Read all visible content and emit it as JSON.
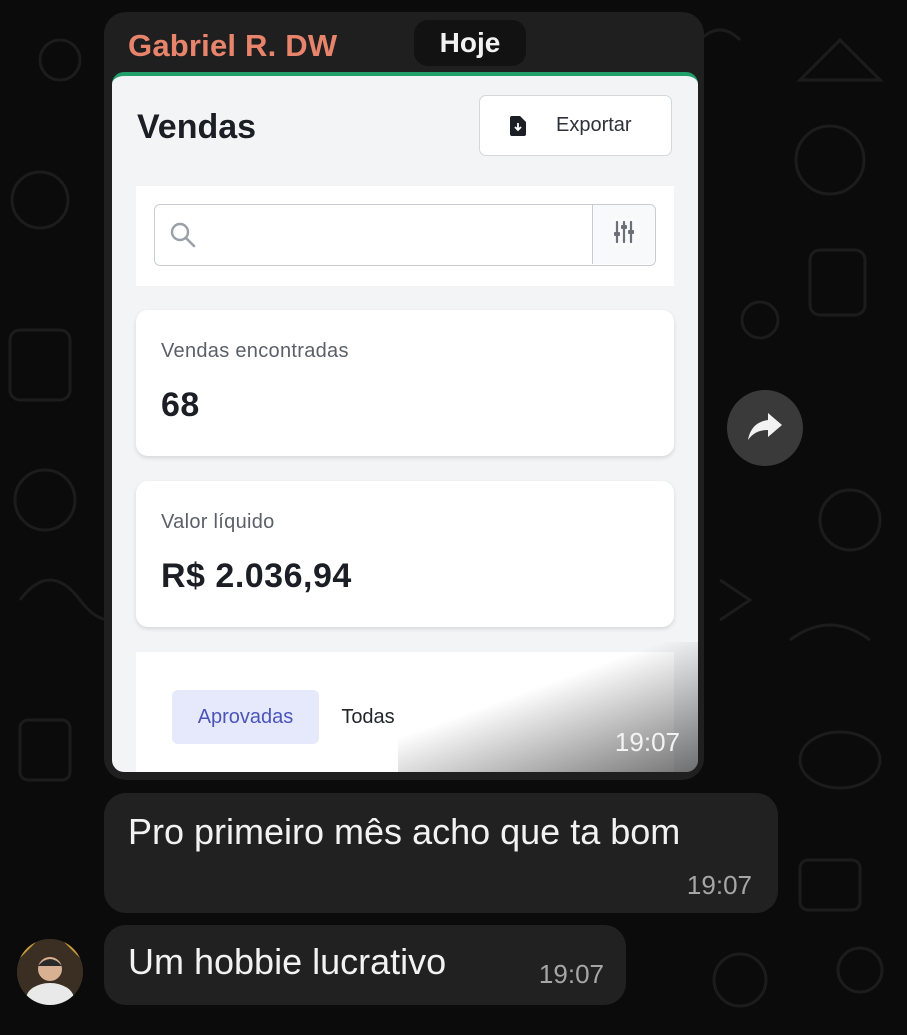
{
  "chat": {
    "sender_name": "Gabriel R. DW",
    "date_label": "Hoje"
  },
  "screenshot": {
    "title": "Vendas",
    "export_label": "Exportar",
    "search_placeholder": "",
    "stats": [
      {
        "label": "Vendas encontradas",
        "value": "68"
      },
      {
        "label": "Valor líquido",
        "value": "R$ 2.036,94"
      }
    ],
    "tabs": [
      {
        "label": "Aprovadas",
        "active": true
      },
      {
        "label": "Todas",
        "active": false
      }
    ],
    "time": "19:07"
  },
  "messages": [
    {
      "text": "Pro primeiro mês acho que ta bom",
      "time": "19:07"
    },
    {
      "text": "Um hobbie lucrativo",
      "time": "19:07"
    }
  ],
  "colors": {
    "sender_name": "#e8846b",
    "bubble": "#212121",
    "accent_line": "#22a06b",
    "tab_active_bg": "#e6e8fb",
    "tab_active_text": "#4b55b8"
  },
  "icons": [
    "export-file-icon",
    "search-icon",
    "filter-sliders-icon",
    "forward-arrow-icon"
  ]
}
